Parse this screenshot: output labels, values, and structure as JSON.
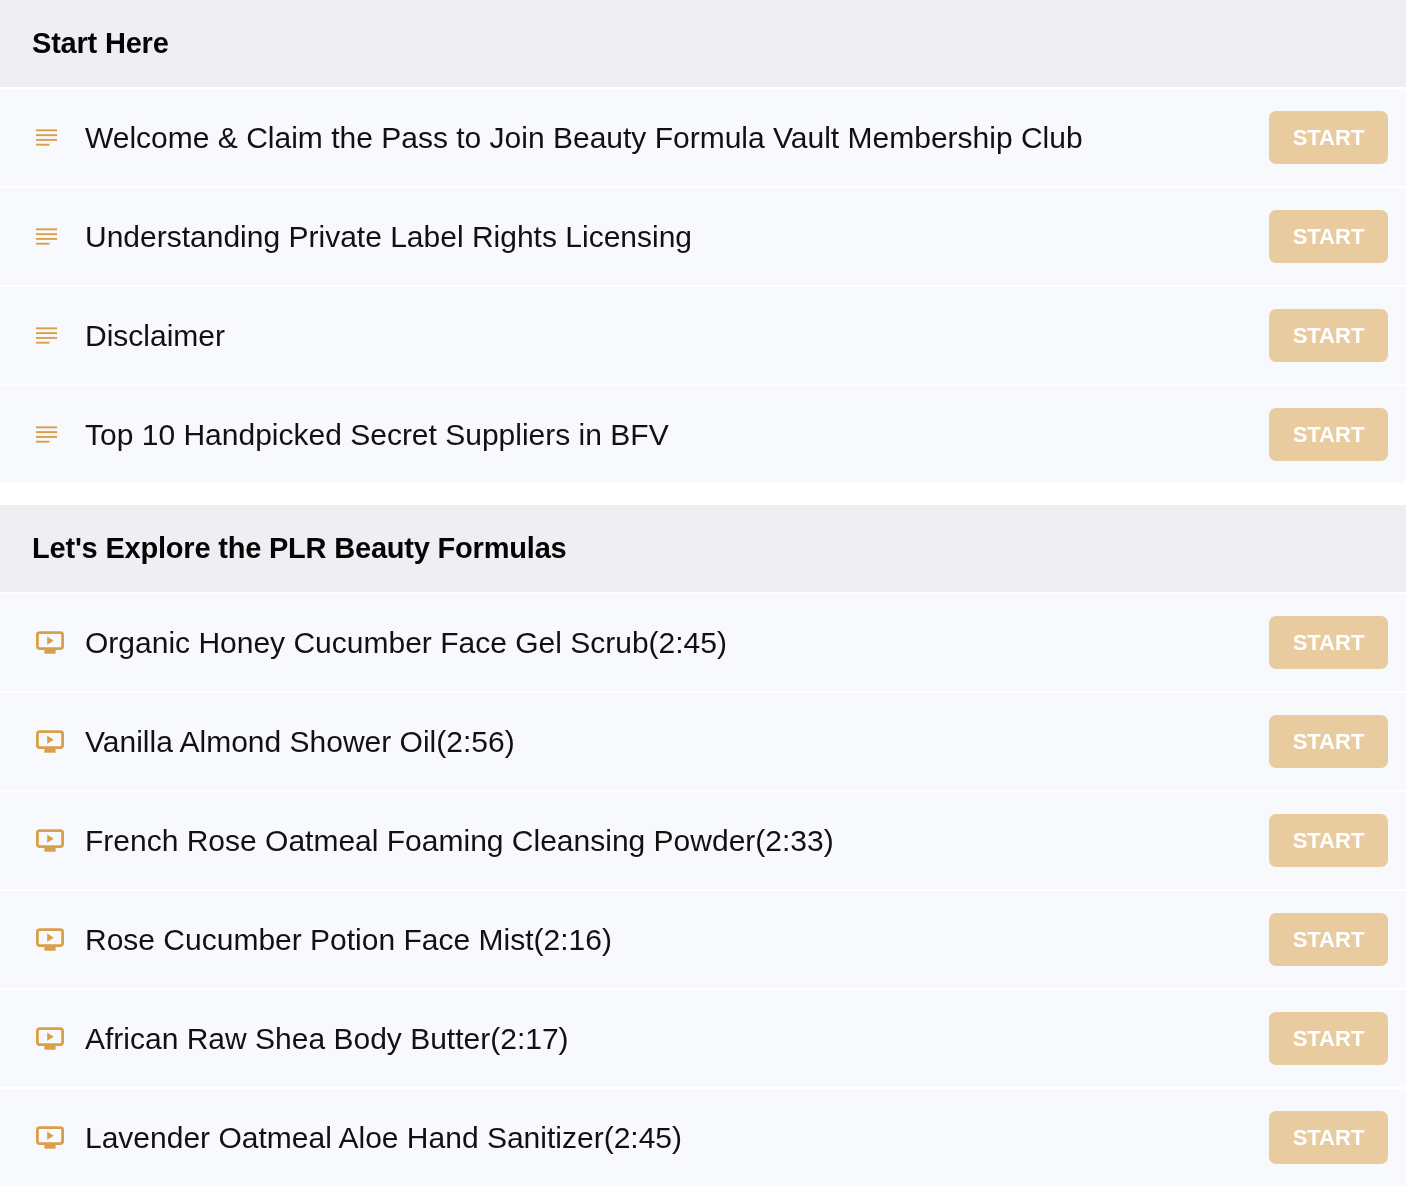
{
  "sections": [
    {
      "title": "Start Here",
      "lessons": [
        {
          "kind": "text",
          "title": "Welcome & Claim the Pass to Join Beauty Formula Vault Membership Club",
          "button": "START"
        },
        {
          "kind": "text",
          "title": "Understanding Private Label Rights Licensing",
          "button": "START"
        },
        {
          "kind": "text",
          "title": "Disclaimer",
          "button": "START"
        },
        {
          "kind": "text",
          "title": "Top 10 Handpicked Secret Suppliers in BFV",
          "button": "START"
        }
      ]
    },
    {
      "title": "Let's Explore the PLR Beauty Formulas",
      "lessons": [
        {
          "kind": "video",
          "title": "Organic Honey Cucumber Face Gel Scrub(2:45)",
          "button": "START"
        },
        {
          "kind": "video",
          "title": "Vanilla Almond Shower Oil(2:56)",
          "button": "START"
        },
        {
          "kind": "video",
          "title": "French Rose Oatmeal Foaming Cleansing Powder(2:33)",
          "button": "START"
        },
        {
          "kind": "video",
          "title": "Rose Cucumber Potion Face Mist(2:16)",
          "button": "START"
        },
        {
          "kind": "video",
          "title": "African Raw Shea Body Butter(2:17)",
          "button": "START"
        },
        {
          "kind": "video",
          "title": "Lavender Oatmeal Aloe Hand Sanitizer(2:45)",
          "button": "START"
        }
      ]
    }
  ]
}
